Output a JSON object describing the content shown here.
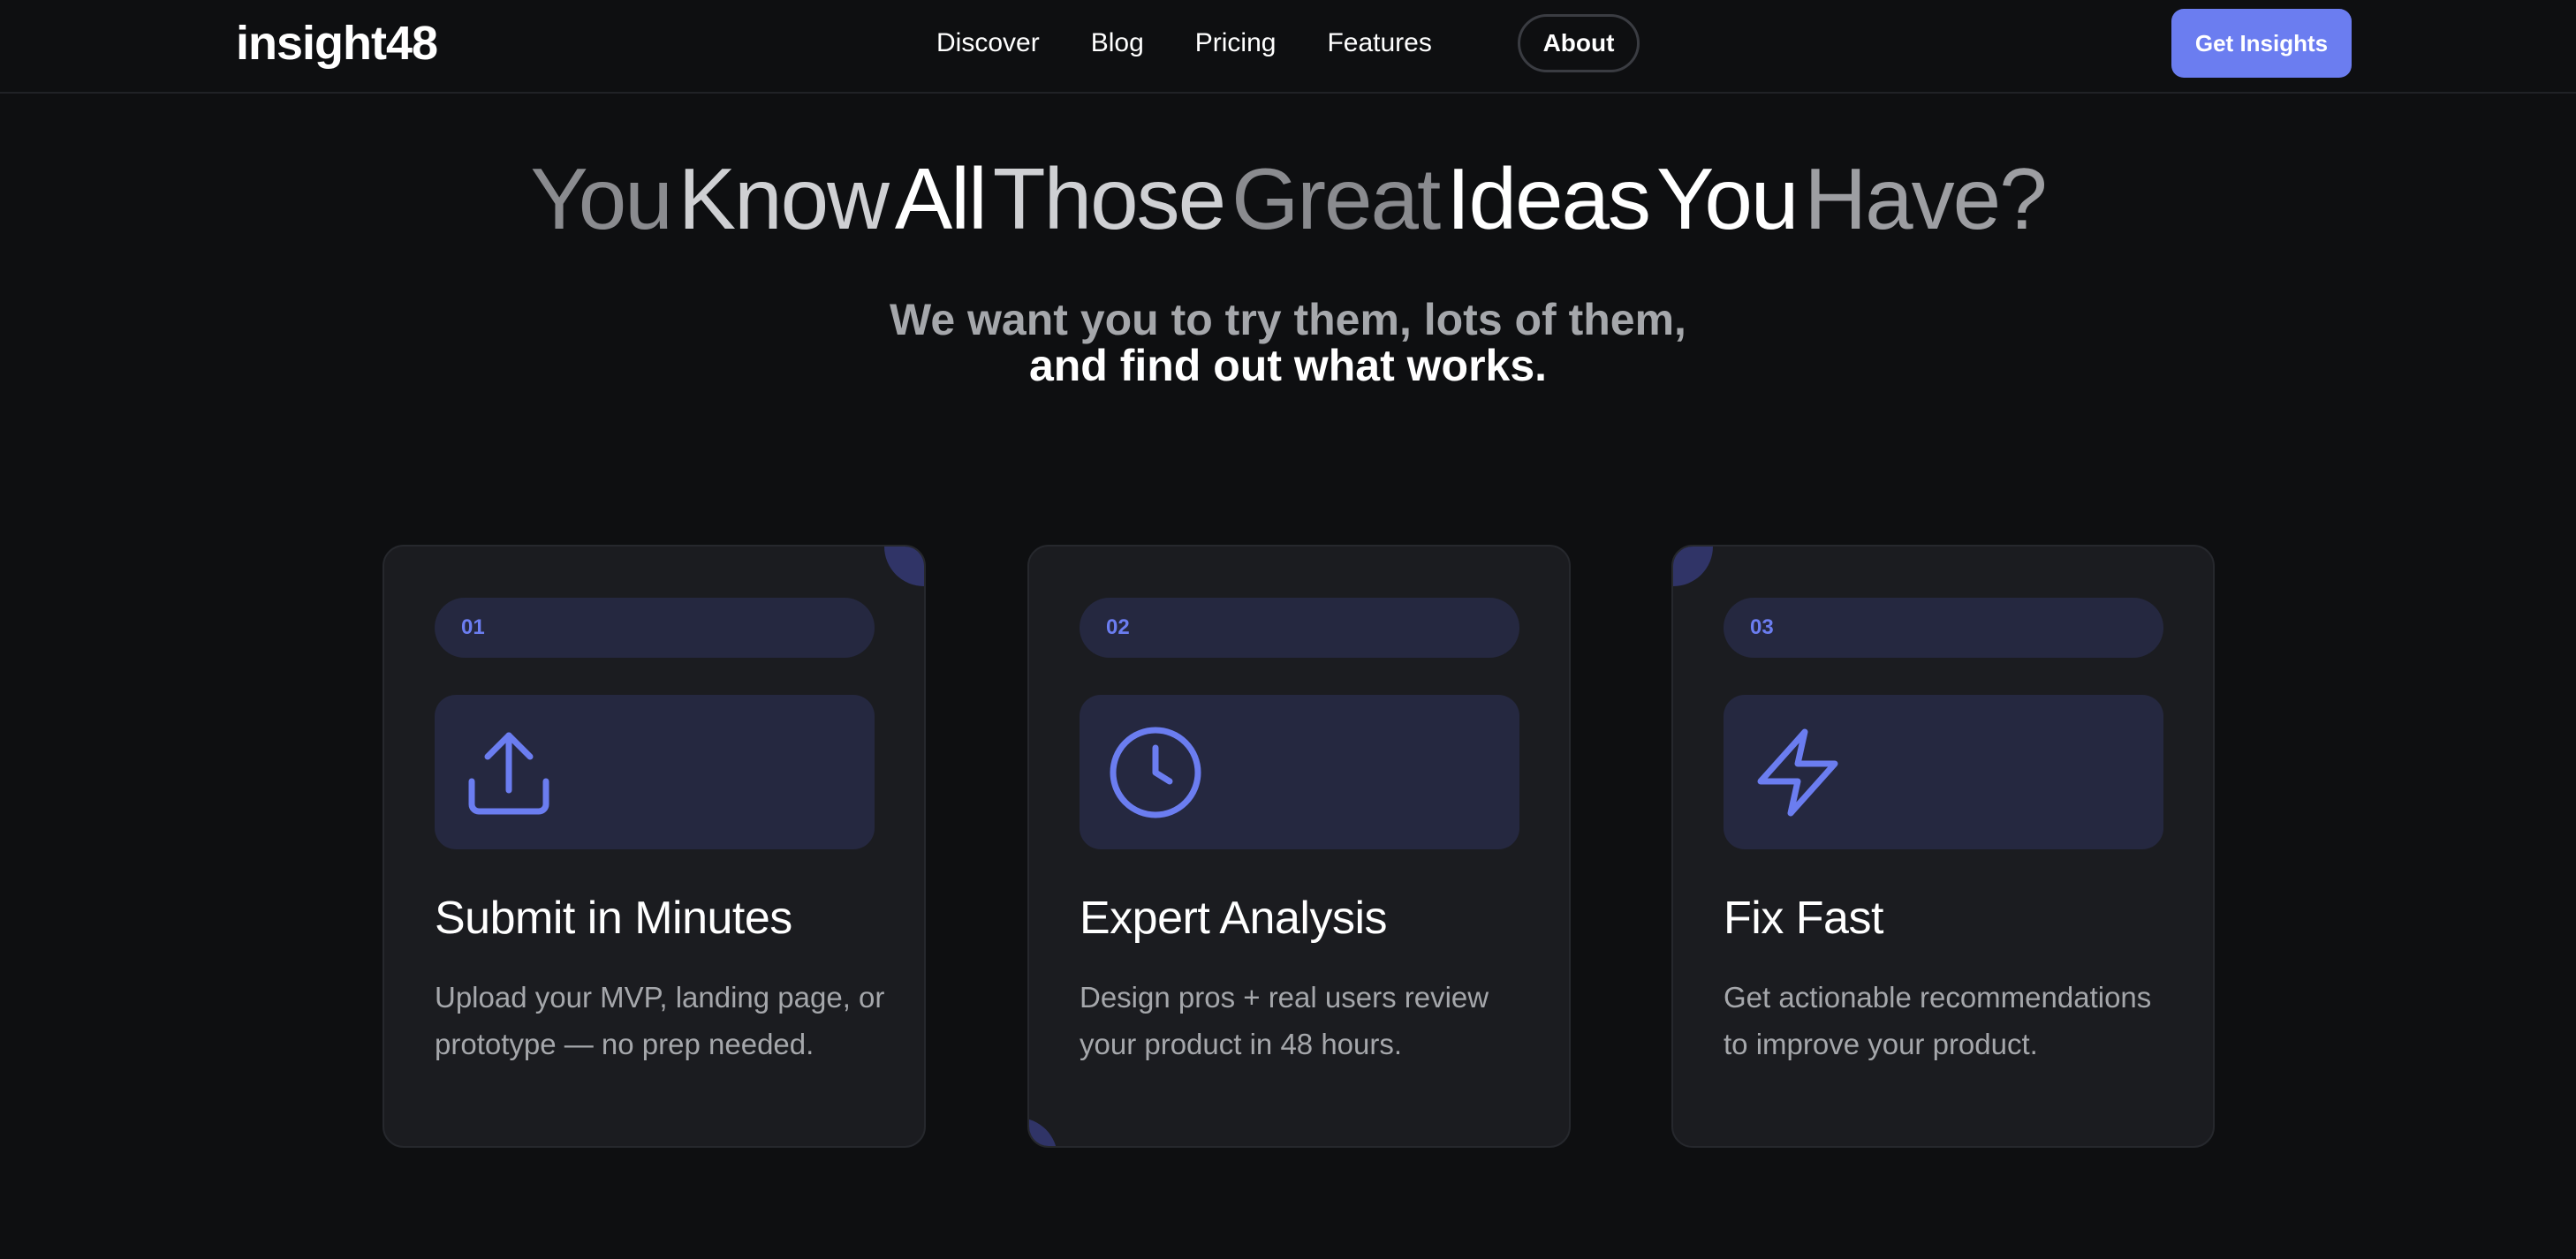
{
  "brand": {
    "logo": "insight48",
    "accent_color": "#6b7df0",
    "background_color": "#0e0f11"
  },
  "nav": {
    "links": [
      {
        "label": "Discover"
      },
      {
        "label": "Blog"
      },
      {
        "label": "Pricing"
      },
      {
        "label": "Features"
      }
    ],
    "pill_label": "About",
    "cta_label": "Get Insights"
  },
  "hero": {
    "title_words": [
      "You",
      "Know",
      "All",
      "Those",
      "Great",
      "Ideas",
      "You",
      "Have?"
    ],
    "subtitle_line1": "We want you to try them, lots of them,",
    "subtitle_line2": "and find out what works."
  },
  "cards": [
    {
      "step": "01",
      "icon": "upload-icon",
      "title": "Submit in Minutes",
      "description": "Upload your MVP, landing page, or prototype — no prep needed."
    },
    {
      "step": "02",
      "icon": "clock-icon",
      "title": "Expert Analysis",
      "description": "Design pros + real users review your product in 48 hours."
    },
    {
      "step": "03",
      "icon": "lightning-icon",
      "title": "Fix Fast",
      "description": "Get actionable recommendations to improve your product."
    }
  ]
}
